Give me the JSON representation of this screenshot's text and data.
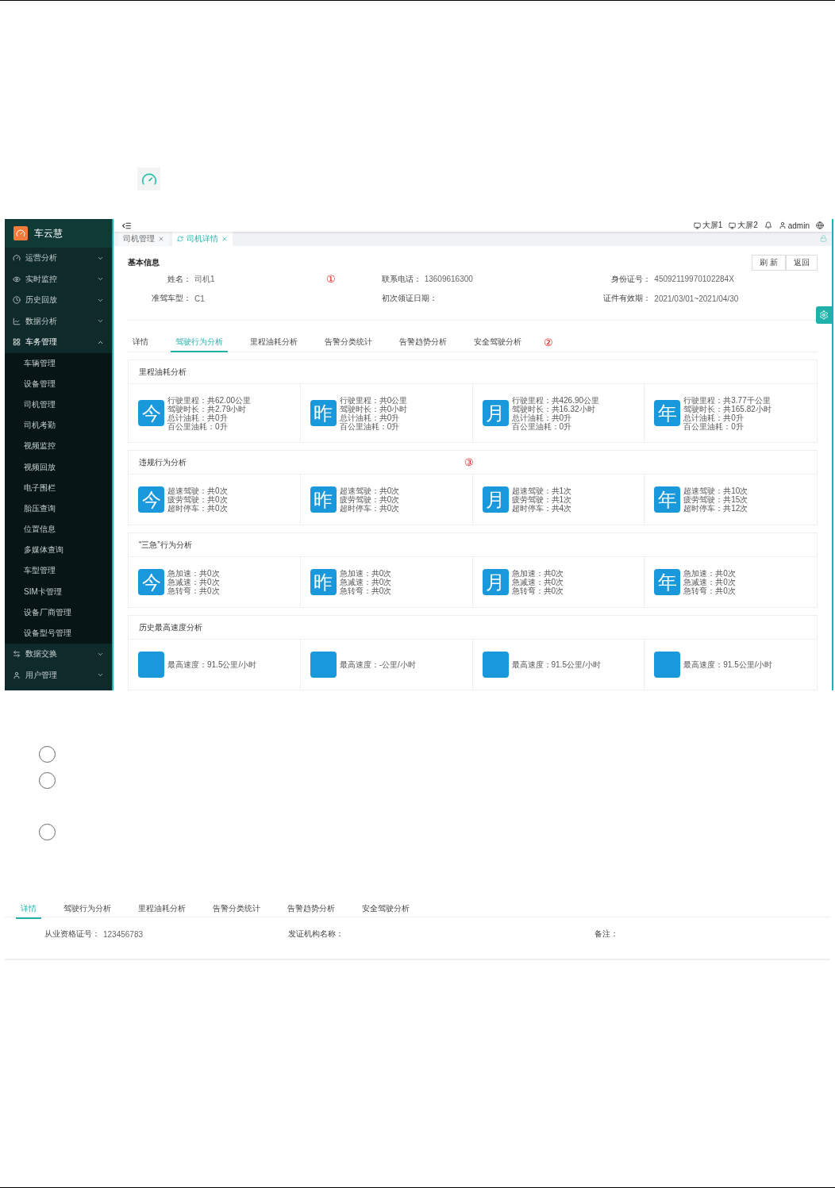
{
  "app": {
    "logo": {
      "title": "车云慧"
    },
    "sidebar": {
      "items": [
        {
          "label": "运营分析",
          "expanded": false
        },
        {
          "label": "实时监控",
          "expanded": false
        },
        {
          "label": "历史回放",
          "expanded": false
        },
        {
          "label": "数据分析",
          "expanded": false
        },
        {
          "label": "车务管理",
          "expanded": true,
          "children": [
            {
              "label": "车辆管理"
            },
            {
              "label": "设备管理"
            },
            {
              "label": "司机管理"
            },
            {
              "label": "司机考勤"
            },
            {
              "label": "视频监控"
            },
            {
              "label": "视频回放"
            },
            {
              "label": "电子围栏"
            },
            {
              "label": "胎压查询"
            },
            {
              "label": "位置信息"
            },
            {
              "label": "多媒体查询"
            },
            {
              "label": "车型管理"
            },
            {
              "label": "SIM卡管理"
            },
            {
              "label": "设备厂商管理"
            },
            {
              "label": "设备型号管理"
            }
          ]
        },
        {
          "label": "数据交换",
          "expanded": false
        },
        {
          "label": "用户管理",
          "expanded": false
        }
      ]
    },
    "toolbar": {
      "screens": [
        "大屏1",
        "大屏2"
      ],
      "user": "admin"
    },
    "page_tabs": [
      {
        "label": "司机管理",
        "selected": false
      },
      {
        "label": "司机详情",
        "selected": true
      }
    ],
    "basic_info": {
      "title": "基本信息",
      "marker": "①",
      "buttons": [
        "刷 新",
        "返回"
      ],
      "fields": [
        {
          "label": "姓名：",
          "value": "司机1"
        },
        {
          "label": "联系电话：",
          "value": "13609616300"
        },
        {
          "label": "身份证号：",
          "value": "45092119970102284X"
        },
        {
          "label": "准驾车型：",
          "value": "C1"
        },
        {
          "label": "初次领证日期："
        },
        {
          "label": "证件有效期：",
          "value": "2021/03/01~2021/04/30"
        }
      ]
    },
    "tabs": [
      {
        "label": "详情",
        "selected": false
      },
      {
        "label": "驾驶行为分析",
        "selected": true
      },
      {
        "label": "里程油耗分析",
        "selected": false
      },
      {
        "label": "告警分类统计",
        "selected": false
      },
      {
        "label": "告警趋势分析",
        "selected": false
      },
      {
        "label": "安全驾驶分析",
        "selected": false
      }
    ],
    "tabs_marker": "②",
    "sections": [
      {
        "title": "里程油耗分析",
        "cards": [
          {
            "period": "今",
            "lines": [
              "行驶里程：共62.00公里",
              "驾驶时长：共2.79小时",
              "总计油耗：共0升",
              "百公里油耗：0升"
            ]
          },
          {
            "period": "昨",
            "lines": [
              "行驶里程：共0公里",
              "驾驶时长：共0小时",
              "总计油耗：共0升",
              "百公里油耗：0升"
            ]
          },
          {
            "period": "月",
            "lines": [
              "行驶里程：共426.90公里",
              "驾驶时长：共16.32小时",
              "总计油耗：共0升",
              "百公里油耗：0升"
            ]
          },
          {
            "period": "年",
            "lines": [
              "行驶里程：共3.77千公里",
              "驾驶时长：共165.82小时",
              "总计油耗：共0升",
              "百公里油耗：0升"
            ]
          }
        ]
      },
      {
        "title": "违规行为分析",
        "marker": "③",
        "cards": [
          {
            "period": "今",
            "lines": [
              "超速驾驶：共0次",
              "疲劳驾驶：共0次",
              "超时停车：共0次"
            ]
          },
          {
            "period": "昨",
            "lines": [
              "超速驾驶：共0次",
              "疲劳驾驶：共0次",
              "超时停车：共0次"
            ]
          },
          {
            "period": "月",
            "lines": [
              "超速驾驶：共1次",
              "疲劳驾驶：共1次",
              "超时停车：共4次"
            ]
          },
          {
            "period": "年",
            "lines": [
              "超速驾驶：共10次",
              "疲劳驾驶：共15次",
              "超时停车：共12次"
            ]
          }
        ]
      },
      {
        "title": "“三急”行为分析",
        "cards": [
          {
            "period": "今",
            "lines": [
              "急加速：共0次",
              "急减速：共0次",
              "急转弯：共0次"
            ]
          },
          {
            "period": "昨",
            "lines": [
              "急加速：共0次",
              "急减速：共0次",
              "急转弯：共0次"
            ]
          },
          {
            "period": "月",
            "lines": [
              "急加速：共0次",
              "急减速：共0次",
              "急转弯：共0次"
            ]
          },
          {
            "period": "年",
            "lines": [
              "急加速：共0次",
              "急减速：共0次",
              "急转弯：共0次"
            ]
          }
        ]
      },
      {
        "title": "历史最高速度分析",
        "cards": [
          {
            "lines": [
              "最高速度：91.5公里/小时"
            ]
          },
          {
            "lines": [
              "最高速度：-公里/小时"
            ]
          },
          {
            "lines": [
              "最高速度：91.5公里/小时"
            ]
          },
          {
            "lines": [
              "最高速度：91.5公里/小时"
            ]
          }
        ]
      }
    ]
  },
  "detail_strip": {
    "tabs": [
      {
        "label": "详情",
        "selected": true
      },
      {
        "label": "驾驶行为分析",
        "selected": false
      },
      {
        "label": "里程油耗分析",
        "selected": false
      },
      {
        "label": "告警分类统计",
        "selected": false
      },
      {
        "label": "告警趋势分析",
        "selected": false
      },
      {
        "label": "安全驾驶分析",
        "selected": false
      }
    ],
    "fields": [
      {
        "label": "从业资格证号：",
        "value": "123456783"
      },
      {
        "label": "发证机构名称："
      },
      {
        "label": "备注："
      }
    ]
  }
}
